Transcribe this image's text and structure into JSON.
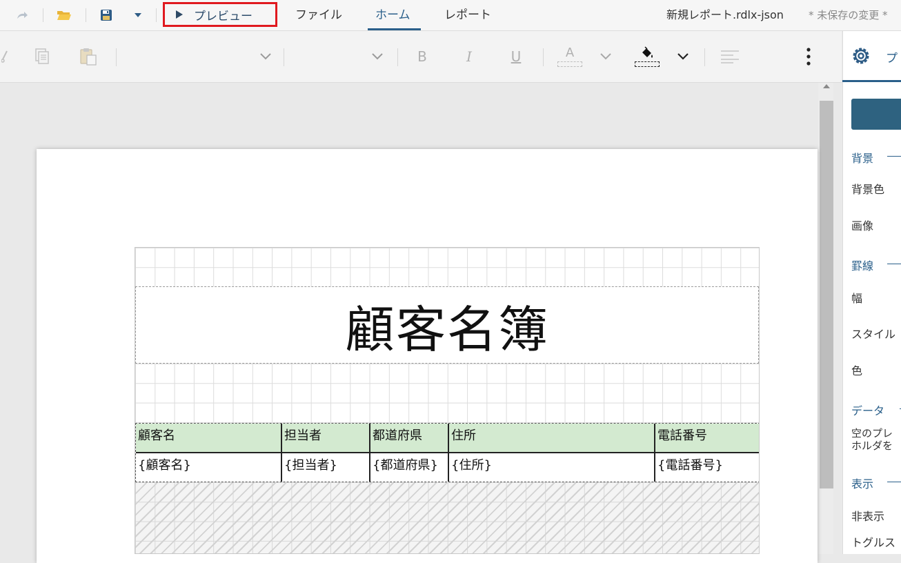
{
  "topbar": {
    "preview_label": "プレビュー",
    "menus": {
      "file": "ファイル",
      "home": "ホーム",
      "report": "レポート"
    },
    "document_title": "新規レポート.rdlx-json",
    "unsaved_status": "* 未保存の変更 *"
  },
  "toolbar": {
    "bold": "B",
    "italic": "I",
    "underline": "U",
    "font_color_letter": "A"
  },
  "report": {
    "title": "顧客名簿",
    "table": {
      "headers": [
        "顧客名",
        "担当者",
        "都道府県",
        "住所",
        "電話番号"
      ],
      "row": [
        "{顧客名}",
        "{担当者}",
        "{都道府県}",
        "{住所}",
        "{電話番号}"
      ]
    }
  },
  "properties_panel": {
    "tab_label": "プ",
    "sections": {
      "background": "背景",
      "background_color": "背景色",
      "image": "画像",
      "border": "罫線",
      "width": "幅",
      "style": "スタイル",
      "color": "色",
      "data": "データ",
      "data_desc_line1": "空のプレ",
      "data_desc_line2": "ホルダを",
      "display": "表示",
      "hidden": "非表示",
      "toggle": "トグルス"
    }
  },
  "colors": {
    "accent": "#2a5f8a",
    "highlight_border": "#e0191f",
    "header_fill": "#d3ead0",
    "panel_button": "#2e6280"
  }
}
